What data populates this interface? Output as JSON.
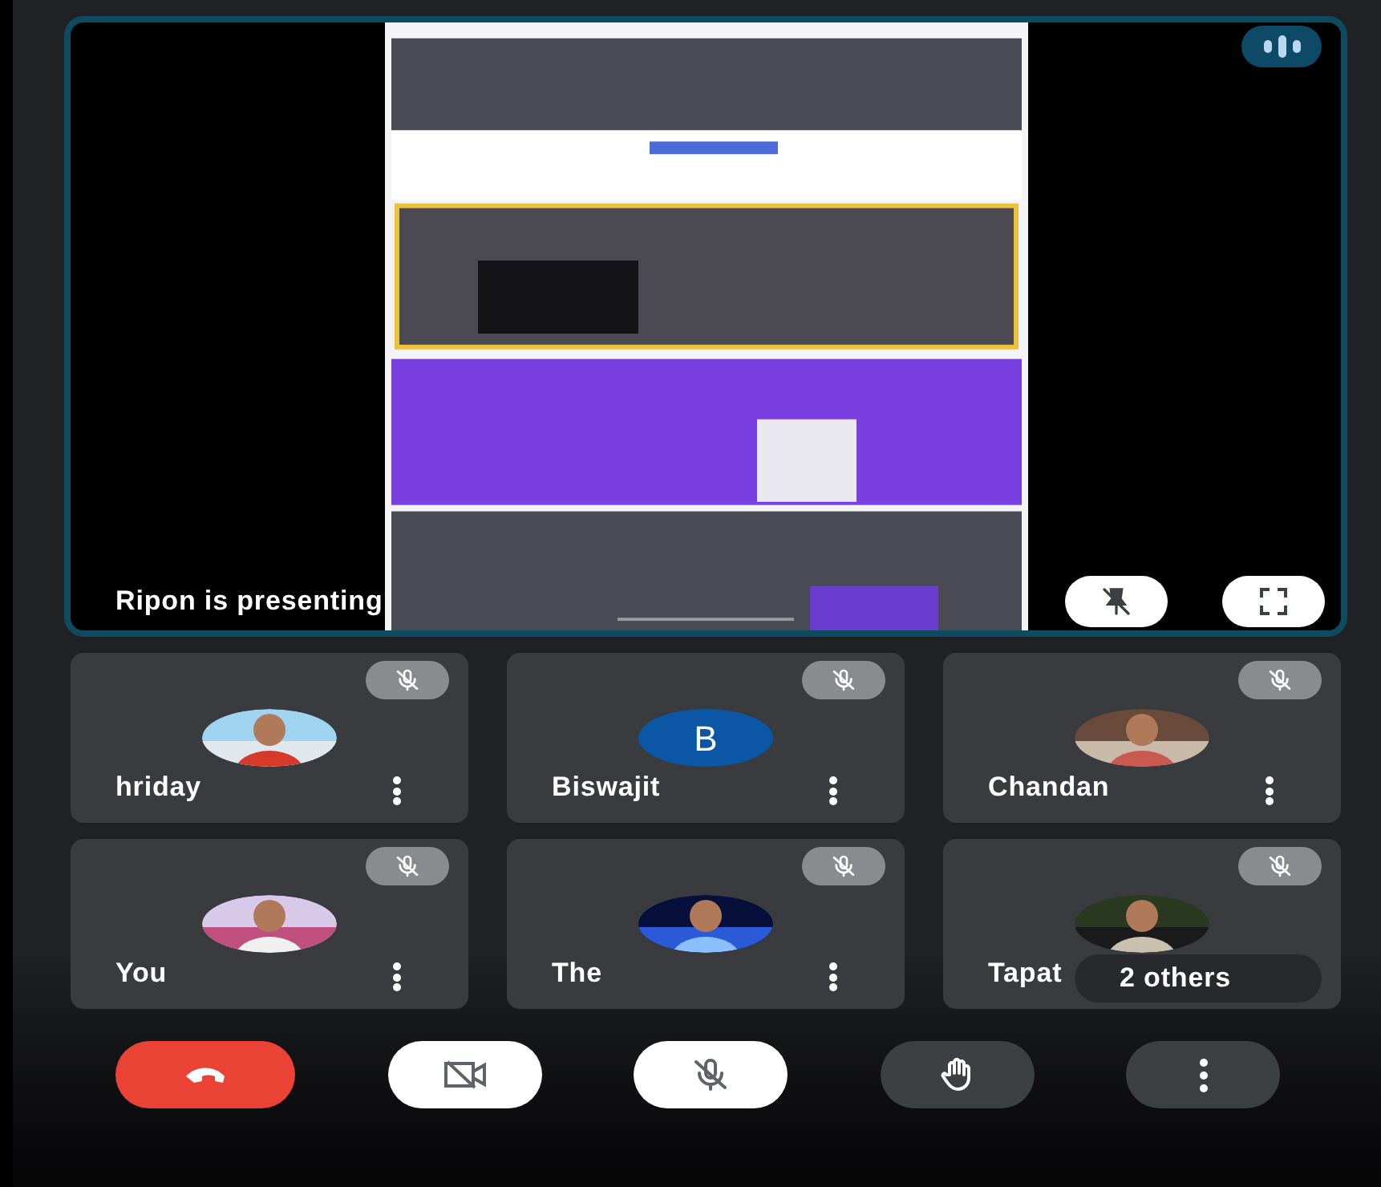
{
  "presentation": {
    "caption": "Ripon is presenting",
    "speaking": true,
    "buttons": [
      {
        "kind": "unpin"
      },
      {
        "kind": "fullscreen"
      }
    ]
  },
  "participants": [
    {
      "name": "hriday",
      "muted": true
    },
    {
      "name": "Biswajit",
      "muted": true,
      "avatar": {
        "kind": "initial",
        "letter": "B",
        "color": "#0b57a5"
      }
    },
    {
      "name": "Chandan",
      "muted": true
    },
    {
      "name": "You",
      "muted": true
    },
    {
      "name": "The",
      "muted": true
    },
    {
      "name": "Tapat",
      "muted": true,
      "overlay": "2 others"
    }
  ],
  "controls": [
    {
      "kind": "end-call"
    },
    {
      "kind": "camera",
      "on": false
    },
    {
      "kind": "microphone",
      "on": false
    },
    {
      "kind": "raise-hand"
    },
    {
      "kind": "more"
    }
  ]
}
